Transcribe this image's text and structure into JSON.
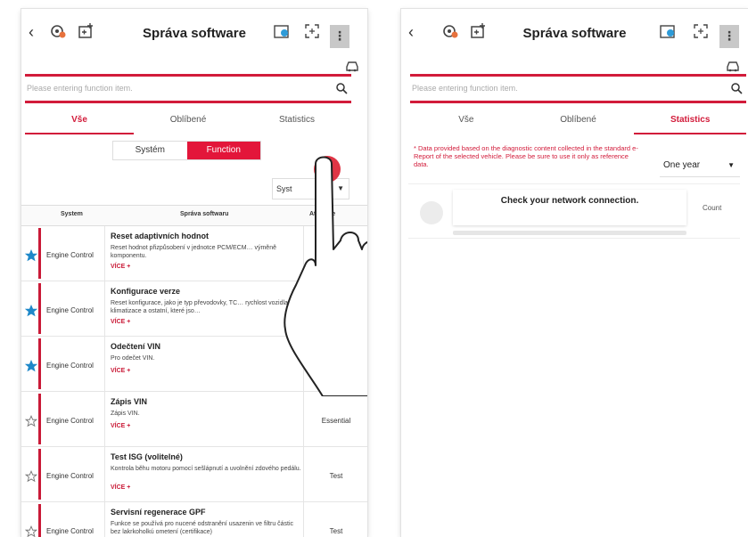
{
  "app_title": "Správa software",
  "search_placeholder": "Please entering function item.",
  "tabs": [
    "Vše",
    "Oblíbené",
    "Statistics"
  ],
  "toggle": {
    "system": "Systém",
    "function": "Function"
  },
  "dropdown_system": "Syst",
  "columns": {
    "system": "System",
    "software": "Správa softwaru",
    "attribute": "Attribute"
  },
  "rows": [
    {
      "favorite": true,
      "system": "Engine Control",
      "name": "Reset adaptivních hodnot",
      "desc": "Reset hodnot přizpůsobení v jednotce PCM/ECM… výměně komponentu.",
      "more": "VÍCE +",
      "attr": ""
    },
    {
      "favorite": true,
      "system": "Engine Control",
      "name": "Konfigurace verze",
      "desc": "Reset konfigurace, jako je typ převodovky, TC… rychlost vozidla, klimatizace a ostatní, které jso…",
      "more": "VÍCE +",
      "attr": ""
    },
    {
      "favorite": true,
      "system": "Engine Control",
      "name": "Odečtení VIN",
      "desc": "Pro odečet VIN.",
      "more": "VÍCE +",
      "attr": ""
    },
    {
      "favorite": false,
      "system": "Engine Control",
      "name": "Zápis VIN",
      "desc": "Zápis VIN.",
      "more": "VÍCE +",
      "attr": "Essential"
    },
    {
      "favorite": false,
      "system": "Engine Control",
      "name": "Test ISG (volitelné)",
      "desc": "Kontrola běhu motoru pomocí sešlápnutí a uvolnění zdového pedálu.",
      "more": "VÍCE +",
      "attr": "Test"
    },
    {
      "favorite": false,
      "system": "Engine Control",
      "name": "Servisní regenerace GPF",
      "desc": "Funkce se používá pro nucené odstranění usazenin ve filtru částic bez lakrkoholkú ometení (certifikace)",
      "more": "",
      "attr": "Test"
    }
  ],
  "statistics": {
    "notice": "* Data provided based on the diagnostic content collected in the standard e-Report of the selected vehicle. Please be sure to use it only as reference data.",
    "range": "One year",
    "network_message": "Check your network connection.",
    "count_label": "Count"
  },
  "colors": {
    "accent": "#d21b3a",
    "favorite_star": "#1e88c9"
  },
  "icons": [
    "back-icon",
    "settings-engine-icon",
    "battery-plus-icon",
    "info-card-icon",
    "screenshot-icon",
    "more-icon",
    "car-icon",
    "search-icon",
    "star-icon"
  ]
}
